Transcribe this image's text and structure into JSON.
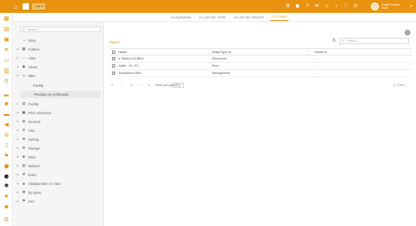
{
  "topbar": {
    "workspace_label": "Hub ▾",
    "user_name": "Dragan Galbjeni",
    "user_sub": "Mistry",
    "icons": [
      "settings-icon",
      "logo-icon",
      "help-icon",
      "mail-icon",
      "headset-icon",
      "bell-icon",
      "heart-icon",
      "chat-icon"
    ]
  },
  "tabs": [
    {
      "label": "CLOUDVIEW",
      "active": false
    },
    {
      "label": "CI LIST BY TYPE",
      "active": false
    },
    {
      "label": "CI LIST BY GROUP",
      "active": false
    },
    {
      "label": "CI VIEWS",
      "active": true
    }
  ],
  "sidebar": {
    "search_placeholder": "Search...",
    "items": [
      {
        "label": "Story",
        "icon": "◔"
      },
      {
        "label": "Folders",
        "icon": "▦"
      },
      {
        "label": "Alias",
        "icon": "─"
      },
      {
        "label": "Views",
        "icon": "◉"
      },
      {
        "label": "Mike",
        "icon": "▭"
      },
      {
        "label": "Facility",
        "icon": "▤"
      },
      {
        "label": "Price electronic",
        "icon": "▣"
      },
      {
        "label": "General",
        "icon": "◍"
      },
      {
        "label": "Also",
        "icon": "✲"
      },
      {
        "label": "Sorting",
        "icon": "⊕"
      },
      {
        "label": "Storage",
        "icon": "⚙"
      },
      {
        "label": "Data",
        "icon": "◈"
      },
      {
        "label": "Netburn",
        "icon": "▥"
      },
      {
        "label": "Extra",
        "icon": "⚙"
      },
      {
        "label": "Adddpunkten CI View",
        "icon": "♣"
      },
      {
        "label": "By types",
        "icon": "⊞"
      },
      {
        "label": "Hon",
        "icon": "⚑"
      }
    ],
    "sub_items": [
      "Facility",
      "Pending my verification"
    ]
  },
  "content": {
    "export_label": "Export",
    "search_placeholder": "Search...",
    "columns": [
      "Name",
      "Entity Type Id",
      "Owner Id"
    ],
    "rows": [
      {
        "name": "E Wadia DOHBS4",
        "type": "Electronics",
        "owner": "-"
      },
      {
        "name": "Sallib - IO - P1",
        "type": "Floor",
        "owner": "-"
      },
      {
        "name": "Standalone Mike",
        "type": "Management",
        "owner": "-"
      }
    ],
    "pager": {
      "first": "«",
      "prev": "‹",
      "page": "1",
      "next": "›",
      "last": "»",
      "per_page_label": "Items per page",
      "per_page_value": "20",
      "range": "1 - 3 of 3"
    }
  },
  "colors": {
    "accent": "#e8920f",
    "sidebar_bg": "#f5f5f5",
    "rail_icon": "#e8920f"
  }
}
